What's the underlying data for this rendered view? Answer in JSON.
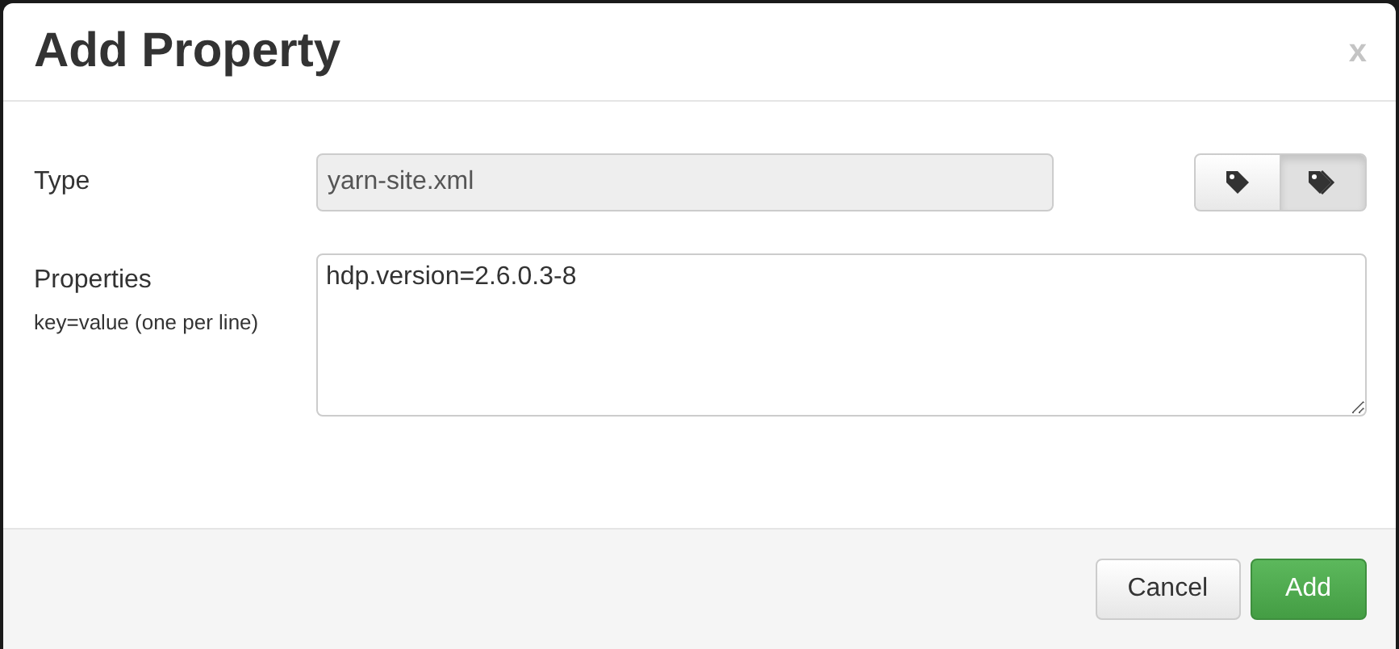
{
  "dialog": {
    "title": "Add Property",
    "close": "x"
  },
  "type_field": {
    "label": "Type",
    "value": "yarn-site.xml",
    "disabled": true
  },
  "tag_buttons": [
    {
      "kind": "single",
      "selected": false
    },
    {
      "kind": "multiple",
      "selected": true
    }
  ],
  "properties_field": {
    "label": "Properties",
    "hint": "key=value (one per line)",
    "value": "hdp.version=2.6.0.3-8"
  },
  "buttons": [
    {
      "label": "Cancel",
      "kind": "default"
    },
    {
      "label": "Add",
      "kind": "primary"
    }
  ]
}
